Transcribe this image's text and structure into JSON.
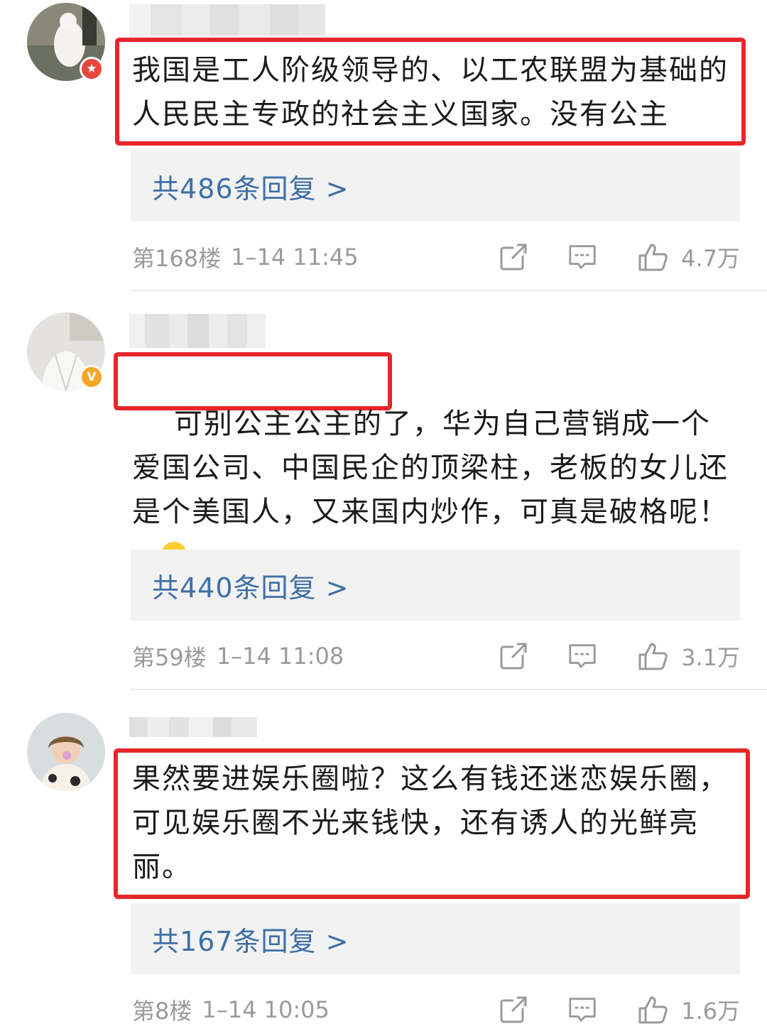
{
  "comments": [
    {
      "text": "我国是工人阶级领导的、以工农联盟为基础的人民民主专政的社会主义国家。没有公主",
      "replies_label": "共486条回复 >",
      "floor": "第168楼",
      "time": "1–14 11:45",
      "likes": "4.7万",
      "badge": "red-star",
      "badge_color": "#e8453c"
    },
    {
      "text_highlight": "可别公主公主的了",
      "text_rest": "，华为自己营销成一个爱国公司、中国民企的顶梁柱，老板的女儿还是个美国人，又来国内炒作，可真是破格呢！",
      "emoji": "shrug-emoji",
      "replies_label": "共440条回复 >",
      "floor": "第59楼",
      "time": "1–14 11:08",
      "likes": "3.1万",
      "badge": "verified-v",
      "badge_color": "#f5a623"
    },
    {
      "text": "果然要进娱乐圈啦？这么有钱还迷恋娱乐圈，可见娱乐圈不光来钱快，还有诱人的光鲜亮丽。",
      "replies_label": "共167条回复 >",
      "floor": "第8楼",
      "time": "1–14 10:05",
      "likes": "1.6万"
    }
  ],
  "icons": {
    "share": "share-icon",
    "comment": "comment-icon",
    "like": "thumbs-up-icon"
  },
  "colors": {
    "highlight_border": "#e6262a",
    "reply_link": "#3e6fa6",
    "meta_text": "#9a9a9a",
    "reply_bg": "#f2f2f2"
  }
}
